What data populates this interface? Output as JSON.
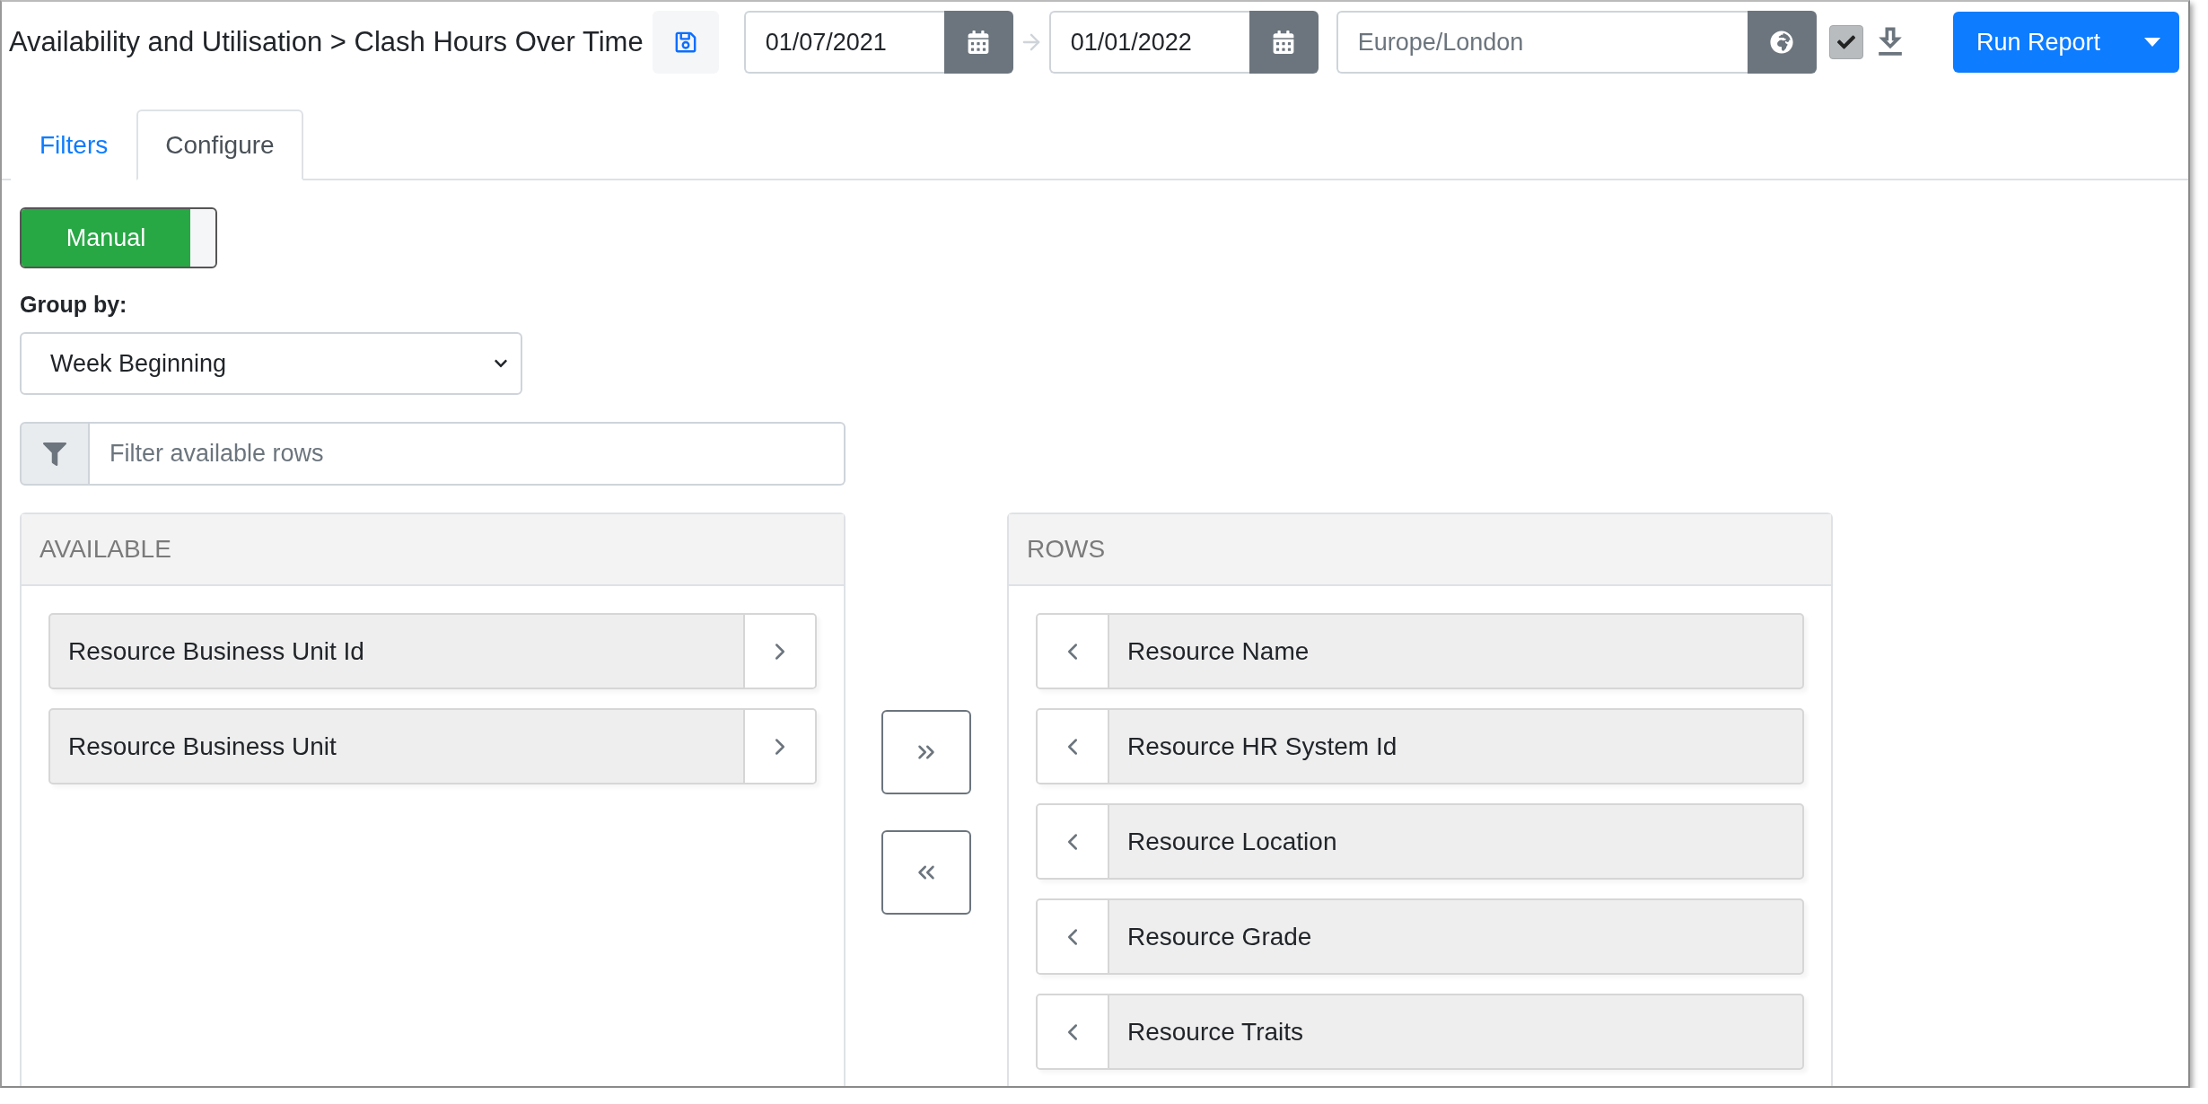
{
  "header": {
    "title": "Availability and Utilisation > Clash Hours Over Time",
    "start_date": "01/07/2021",
    "end_date": "01/01/2022",
    "timezone_placeholder": "Europe/London",
    "include_checked": true,
    "run_button": "Run Report"
  },
  "tabs": [
    {
      "label": "Filters",
      "selected": false
    },
    {
      "label": "Configure",
      "selected": true
    }
  ],
  "mode_toggle": {
    "label": "Manual",
    "on": true
  },
  "group_by": {
    "label": "Group by:",
    "value": "Week Beginning"
  },
  "filter": {
    "placeholder": "Filter available rows"
  },
  "available": {
    "title": "AVAILABLE",
    "items": [
      "Resource Business Unit Id",
      "Resource Business Unit"
    ]
  },
  "rows": {
    "title": "ROWS",
    "items": [
      "Resource Name",
      "Resource HR System Id",
      "Resource Location",
      "Resource Grade",
      "Resource Traits"
    ]
  }
}
